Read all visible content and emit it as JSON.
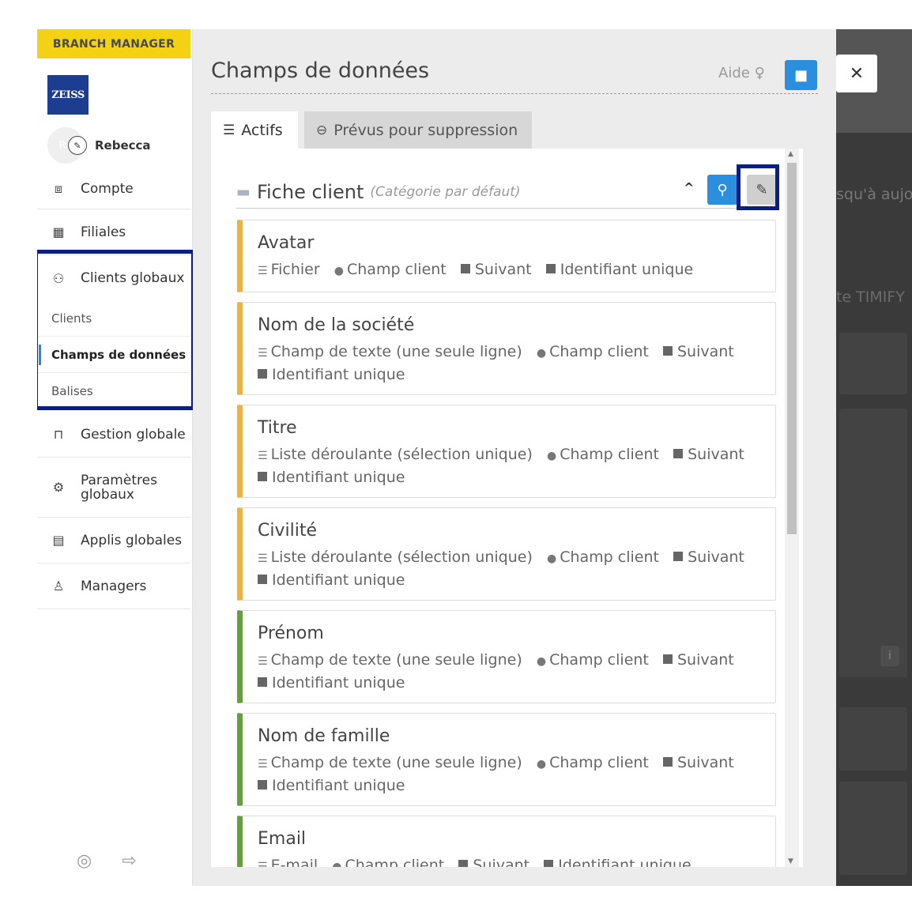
{
  "sidebar": {
    "role": "BRANCH MANAGER",
    "logo_text": "ZEISS",
    "user": {
      "initial": "R",
      "name": "Rebecca"
    },
    "nav": {
      "account": "Compte",
      "branches": "Filiales",
      "global_customers": "Clients globaux",
      "customers": "Clients",
      "data_fields": "Champs de données",
      "tags": "Balises",
      "global_management": "Gestion globale",
      "global_settings_1": "Paramètres",
      "global_settings_2": "globaux",
      "global_apps": "Applis globales",
      "managers": "Managers"
    }
  },
  "panel": {
    "title": "Champs de données",
    "help": "Aide",
    "tabs": {
      "active": "Actifs",
      "scheduled_delete": "Prévus pour suppression"
    },
    "category": {
      "name": "Fiche client",
      "sub": "(Catégorie par défaut)"
    },
    "fields": [
      {
        "title": "Avatar",
        "type": "Fichier",
        "scope": "Champ client",
        "next": "Suivant",
        "unique": "Identifiant unique"
      },
      {
        "title": "Nom de la société",
        "type": "Champ de texte (une seule ligne)",
        "scope": "Champ client",
        "next": "Suivant",
        "unique": "Identifiant unique"
      },
      {
        "title": "Titre",
        "type": "Liste déroulante (sélection unique)",
        "scope": "Champ client",
        "next": "Suivant",
        "unique": "Identifiant unique"
      },
      {
        "title": "Civilité",
        "type": "Liste déroulante (sélection unique)",
        "scope": "Champ client",
        "next": "Suivant",
        "unique": "Identifiant unique"
      },
      {
        "title": "Prénom",
        "type": "Champ de texte (une seule ligne)",
        "scope": "Champ client",
        "next": "Suivant",
        "unique": "Identifiant unique"
      },
      {
        "title": "Nom de famille",
        "type": "Champ de texte (une seule ligne)",
        "scope": "Champ client",
        "next": "Suivant",
        "unique": "Identifiant unique"
      },
      {
        "title": "Email",
        "type": "E-mail",
        "scope": "Champ client",
        "next": "Suivant",
        "unique": "Identifiant unique"
      }
    ]
  },
  "background": {
    "text1": "squ'à aujo",
    "text2": "te TIMIFY"
  },
  "colors": {
    "accent_blue": "#2a8fde",
    "role_yellow": "#f3d214",
    "highlight_navy": "#0c1e80",
    "bar_orange": "#e9b24c",
    "bar_green": "#6a9a45"
  }
}
